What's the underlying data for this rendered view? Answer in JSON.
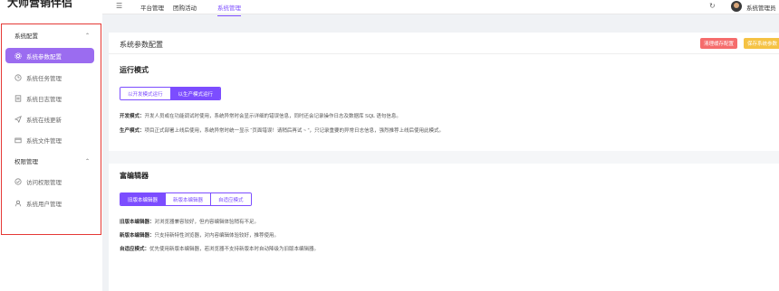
{
  "brand": {
    "title": "大师营销伴侣"
  },
  "sidebar": {
    "groups": [
      {
        "label": "系统配置",
        "items": [
          {
            "label": "系统参数配置",
            "icon": "gear-icon",
            "active": true
          },
          {
            "label": "系统任务管理",
            "icon": "clock-icon"
          },
          {
            "label": "系统日志管理",
            "icon": "document-icon"
          },
          {
            "label": "系统在线更新",
            "icon": "send-icon"
          },
          {
            "label": "系统文件管理",
            "icon": "folder-icon"
          }
        ]
      },
      {
        "label": "权限管理",
        "items": [
          {
            "label": "访问权限管理",
            "icon": "shield-check-icon"
          },
          {
            "label": "系统用户管理",
            "icon": "user-icon"
          }
        ]
      }
    ]
  },
  "topbar": {
    "tabs": [
      "平台管理",
      "团购活动",
      "系统管理"
    ],
    "active_tab": "系统管理",
    "user_name": "系统管理员"
  },
  "panel": {
    "title": "系统参数配置",
    "buttons": {
      "clear_cache": "清理缓存配置",
      "save": "保存系统参数"
    },
    "run_mode": {
      "title": "运行模式",
      "options": [
        "以开发模式运行",
        "以生产模式运行"
      ],
      "selected": "以生产模式运行",
      "desc_dev_label": "开发模式：",
      "desc_dev": "开发人员或在功能调试时使用，系统异常时会显示详细的错误信息，同时还会记录操作日志及数据库 SQL 语句信息。",
      "desc_prod_label": "生产模式：",
      "desc_prod": "项目正式部署上线后使用，系统异常时统一显示 “页面错误！请稍后再试 ~ ”，只记录重要的异常日志信息，强烈推荐上线后使用此模式。"
    },
    "editor": {
      "title": "富编辑器",
      "options": [
        "旧版本编辑器",
        "新版本编辑器",
        "自适应模式"
      ],
      "selected": "旧版本编辑器",
      "desc_old_label": "旧版本编辑器：",
      "desc_old": "对浏览器兼容较好，但内容编辑体验稍有不足。",
      "desc_new_label": "新版本编辑器：",
      "desc_new": "只支持新特性浏览器，对内容编辑体验较好，推荐使用。",
      "desc_auto_label": "自适应模式：",
      "desc_auto": "优先使用新版本编辑器，若浏览器不支持新版本时自动降级为旧版本编辑器。"
    }
  },
  "colors": {
    "accent": "#7c4dff",
    "danger": "#f56c6c",
    "warning": "#f5c243",
    "highlight_box": "#e53935"
  }
}
